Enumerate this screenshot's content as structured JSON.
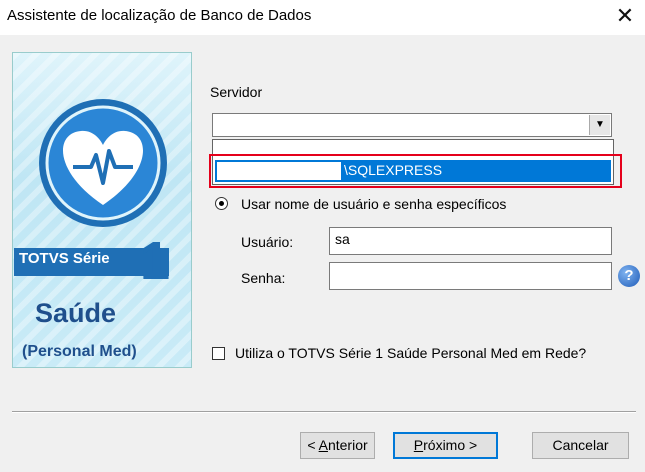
{
  "window": {
    "title": "Assistente de localização de Banco de Dados",
    "close_glyph": "✕"
  },
  "banner": {
    "brand": "TOTVS Série",
    "series_number": "1",
    "product": "Saúde",
    "edition": "(Personal Med)"
  },
  "servidor": {
    "label": "Servidor",
    "value": "",
    "dropdown_selected_suffix": "\\SQLEXPRESS",
    "arrow": "▼"
  },
  "auth": {
    "radio_label": "Usar nome de usuário e senha específicos"
  },
  "usuario": {
    "label": "Usuário:",
    "value": "sa"
  },
  "senha": {
    "label": "Senha:",
    "value": ""
  },
  "help": {
    "glyph": "?"
  },
  "network_option": {
    "label": "Utiliza o TOTVS Série 1 Saúde Personal Med em Rede?",
    "checked": false
  },
  "buttons": {
    "back_prefix": "< ",
    "back_accel": "A",
    "back_rest": "nterior",
    "next_accel": "P",
    "next_rest": "róximo >",
    "cancel": "Cancelar"
  },
  "colors": {
    "selection": "#0078d7",
    "highlight_box": "#e5001b",
    "brand_blue": "#1f6fb5"
  }
}
